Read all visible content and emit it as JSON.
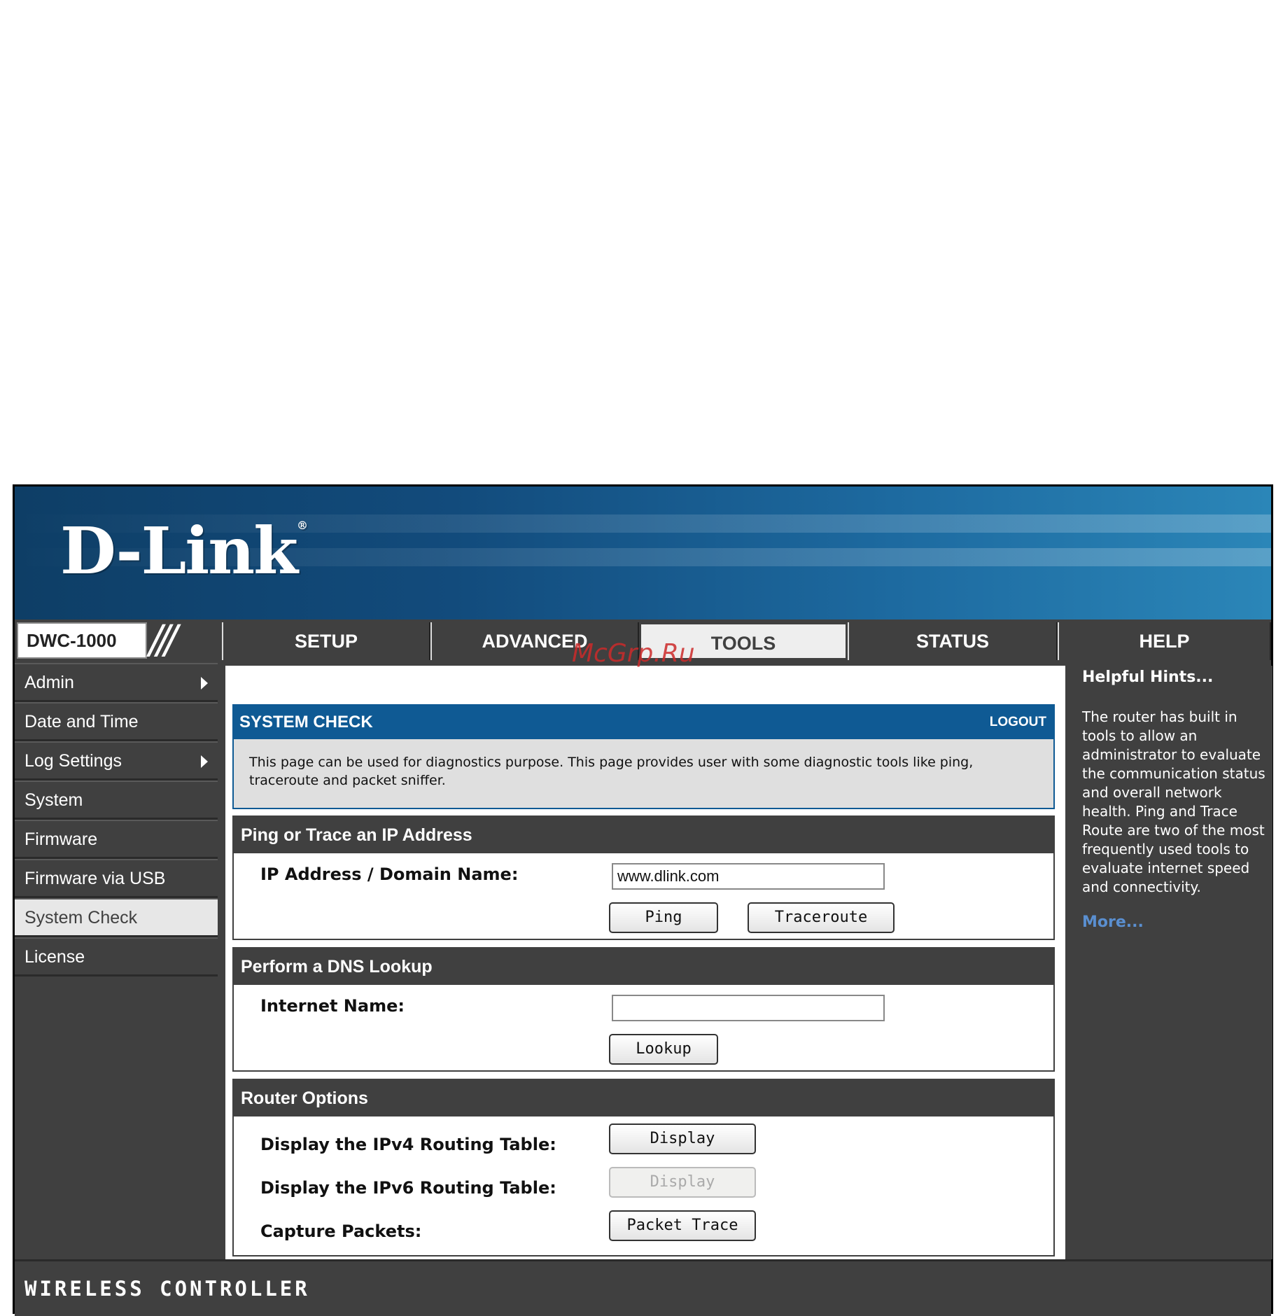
{
  "brand": {
    "logo": "D-Link",
    "registered": "®",
    "model": "DWC-1000"
  },
  "nav": {
    "tabs": [
      {
        "label": "SETUP"
      },
      {
        "label": "ADVANCED"
      },
      {
        "label": "TOOLS",
        "active": true
      },
      {
        "label": "STATUS"
      },
      {
        "label": "HELP"
      }
    ]
  },
  "sidebar": {
    "items": [
      {
        "label": "Admin",
        "has_submenu": true
      },
      {
        "label": "Date and Time"
      },
      {
        "label": "Log Settings",
        "has_submenu": true
      },
      {
        "label": "System"
      },
      {
        "label": "Firmware"
      },
      {
        "label": "Firmware via USB"
      },
      {
        "label": "System Check",
        "active": true
      },
      {
        "label": "License"
      }
    ]
  },
  "page": {
    "title": "SYSTEM CHECK",
    "logout": "LOGOUT",
    "description": "This page can be used for diagnostics purpose. This page provides user with some diagnostic tools like ping, traceroute and packet sniffer."
  },
  "ping_section": {
    "header": "Ping or Trace an IP Address",
    "label": "IP Address / Domain Name:",
    "value": "www.dlink.com",
    "ping_button": "Ping",
    "traceroute_button": "Traceroute"
  },
  "dns_section": {
    "header": "Perform a DNS Lookup",
    "label": "Internet Name:",
    "value": "",
    "lookup_button": "Lookup"
  },
  "router_section": {
    "header": "Router Options",
    "ipv4_label": "Display the IPv4 Routing Table:",
    "ipv4_button": "Display",
    "ipv6_label": "Display the IPv6 Routing Table:",
    "ipv6_button": "Display",
    "capture_label": "Capture Packets:",
    "capture_button": "Packet Trace"
  },
  "hints": {
    "title": "Helpful Hints...",
    "body": "The router has built in tools to allow an administrator to evaluate the communication status and overall network health. Ping and Trace Route are two of the most frequently used tools to evaluate internet speed and connectivity.",
    "more": "More..."
  },
  "footer": {
    "text": "WIRELESS CONTROLLER"
  },
  "watermark": "McGrp.Ru",
  "colors": {
    "title_blue": "#0f5a94",
    "dark_gray": "#404040",
    "link_blue": "#5a8fd0",
    "watermark_red": "#cc2a2a"
  }
}
